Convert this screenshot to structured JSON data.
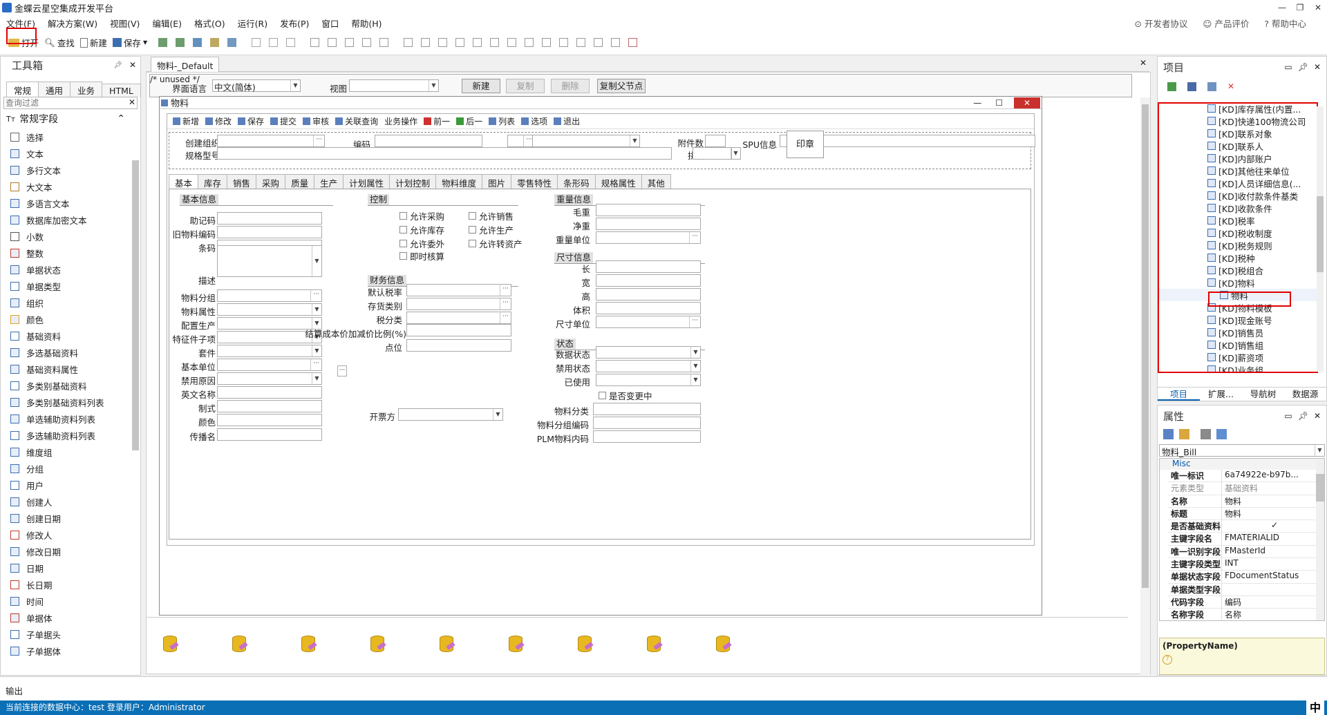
{
  "app": {
    "title": "金蝶云星空集成开发平台"
  },
  "menu": [
    "文件(F)",
    "解决方案(W)",
    "视图(V)",
    "编辑(E)",
    "格式(O)",
    "运行(R)",
    "发布(P)",
    "窗口",
    "帮助(H)"
  ],
  "right_links": {
    "dev": "开发者协议",
    "rate": "产品评价",
    "help": "帮助中心"
  },
  "toolbar": {
    "open": "打开",
    "find": "查找",
    "new": "新建",
    "save": "保存"
  },
  "toolbox": {
    "title": "工具箱",
    "tabs": [
      "常规",
      "通用",
      "业务",
      "HTML"
    ],
    "filter_placeholder": "查询过滤",
    "group": "常规字段",
    "items": [
      "选择",
      "文本",
      "多行文本",
      "大文本",
      "多语言文本",
      "数据库加密文本",
      "小数",
      "整数",
      "单据状态",
      "单据类型",
      "组织",
      "颜色",
      "基础资料",
      "多选基础资料",
      "基础资料属性",
      "多类别基础资料",
      "多类别基础资料列表",
      "单选辅助资料列表",
      "多选辅助资料列表",
      "维度组",
      "分组",
      "用户",
      "创建人",
      "创建日期",
      "修改人",
      "修改日期",
      "日期",
      "长日期",
      "时间",
      "单据体",
      "子单据头",
      "子单据体"
    ]
  },
  "doc_tab": "物料-_Default",
  "editor_bar": {
    "lang_label": "界面语言",
    "lang_value": "中文(简体)",
    "view_label": "视图",
    "btn_new": "新建",
    "btn_copy": "复制",
    "btn_delete": "删除",
    "btn_copy_parent": "复制父节点"
  },
  "form": {
    "title": "物料",
    "toolbar": [
      "新增",
      "修改",
      "保存",
      "提交",
      "审核",
      "关联查询",
      "业务操作",
      "前一",
      "后一",
      "列表",
      "选项",
      "退出"
    ],
    "head": {
      "create_org": "创建组织",
      "code": "编码",
      "attach_count": "附件数",
      "spu": "SPU信息",
      "spec": "规格型号",
      "pinyin": "拼音",
      "stamp": "印章"
    },
    "tabs": [
      "基本",
      "库存",
      "销售",
      "采购",
      "质量",
      "生产",
      "计划属性",
      "计划控制",
      "物料维度",
      "图片",
      "零售特性",
      "条形码",
      "规格属性",
      "其他"
    ],
    "basic_section": "基本信息",
    "basic_fields": [
      "助记码",
      "旧物料编码",
      "条码",
      "描述",
      "物料分组",
      "物料属性",
      "配置生产",
      "特征件子项",
      "套件",
      "基本单位",
      "禁用原因",
      "英文名称",
      "制式",
      "颜色",
      "传播名"
    ],
    "control_section": "控制",
    "control_checks": [
      "允许采购",
      "允许销售",
      "允许库存",
      "允许生产",
      "允许委外",
      "允许转资产",
      "即时核算"
    ],
    "finance_section": "财务信息",
    "finance_fields": [
      "默认税率",
      "存货类别",
      "税分类",
      "结算成本价加减价比例(%)",
      "点位"
    ],
    "invoice_label": "开票方",
    "weight_section": "重量信息",
    "weight_fields": [
      "毛重",
      "净重",
      "重量单位"
    ],
    "size_section": "尺寸信息",
    "size_fields": [
      "长",
      "宽",
      "高",
      "体积",
      "尺寸单位"
    ],
    "status_section": "状态",
    "status_fields": [
      "数据状态",
      "禁用状态",
      "已使用"
    ],
    "changing_label": "是否变更中",
    "extra_fields": [
      "物料分类",
      "物料分组编码",
      "PLM物料内码"
    ]
  },
  "project": {
    "title": "项目",
    "items": [
      "[KD]库存属性(内置...",
      "[KD]快递100物流公司",
      "[KD]联系对象",
      "[KD]联系人",
      "[KD]内部账户",
      "[KD]其他往来单位",
      "[KD]人员详细信息(...",
      "[KD]收付款条件基类",
      "[KD]收款条件",
      "[KD]税率",
      "[KD]税收制度",
      "[KD]税务规则",
      "[KD]税种",
      "[KD]税组合",
      "[KD]物料",
      "物料",
      "[KD]物料模板",
      "[KD]现金账号",
      "[KD]销售员",
      "[KD]销售组",
      "[KD]薪资项",
      "[KD]业务组"
    ],
    "tabs": [
      "项目",
      "扩展...",
      "导航树",
      "数据源"
    ]
  },
  "properties": {
    "title": "属性",
    "selector": "物料_Bill",
    "category": "Misc",
    "rows": [
      [
        "唯一标识",
        "6a74922e-b97b..."
      ],
      [
        "元素类型",
        "基础资料"
      ],
      [
        "名称",
        "物料"
      ],
      [
        "标题",
        "物料"
      ],
      [
        "是否基础资料",
        "✓"
      ],
      [
        "主键字段名",
        "FMATERIALID"
      ],
      [
        "唯一识别字段",
        "FMasterId"
      ],
      [
        "主键字段类型",
        "INT"
      ],
      [
        "单据状态字段",
        "FDocumentStatus"
      ],
      [
        "单据类型字段",
        ""
      ],
      [
        "代码字段",
        "编码"
      ],
      [
        "名称字段",
        "名称"
      ]
    ],
    "desc_title": "(PropertyName)"
  },
  "output_label": "输出",
  "status_bar": {
    "text": "当前连接的数据中心：test  登录用户：Administrator",
    "ime": "中"
  }
}
